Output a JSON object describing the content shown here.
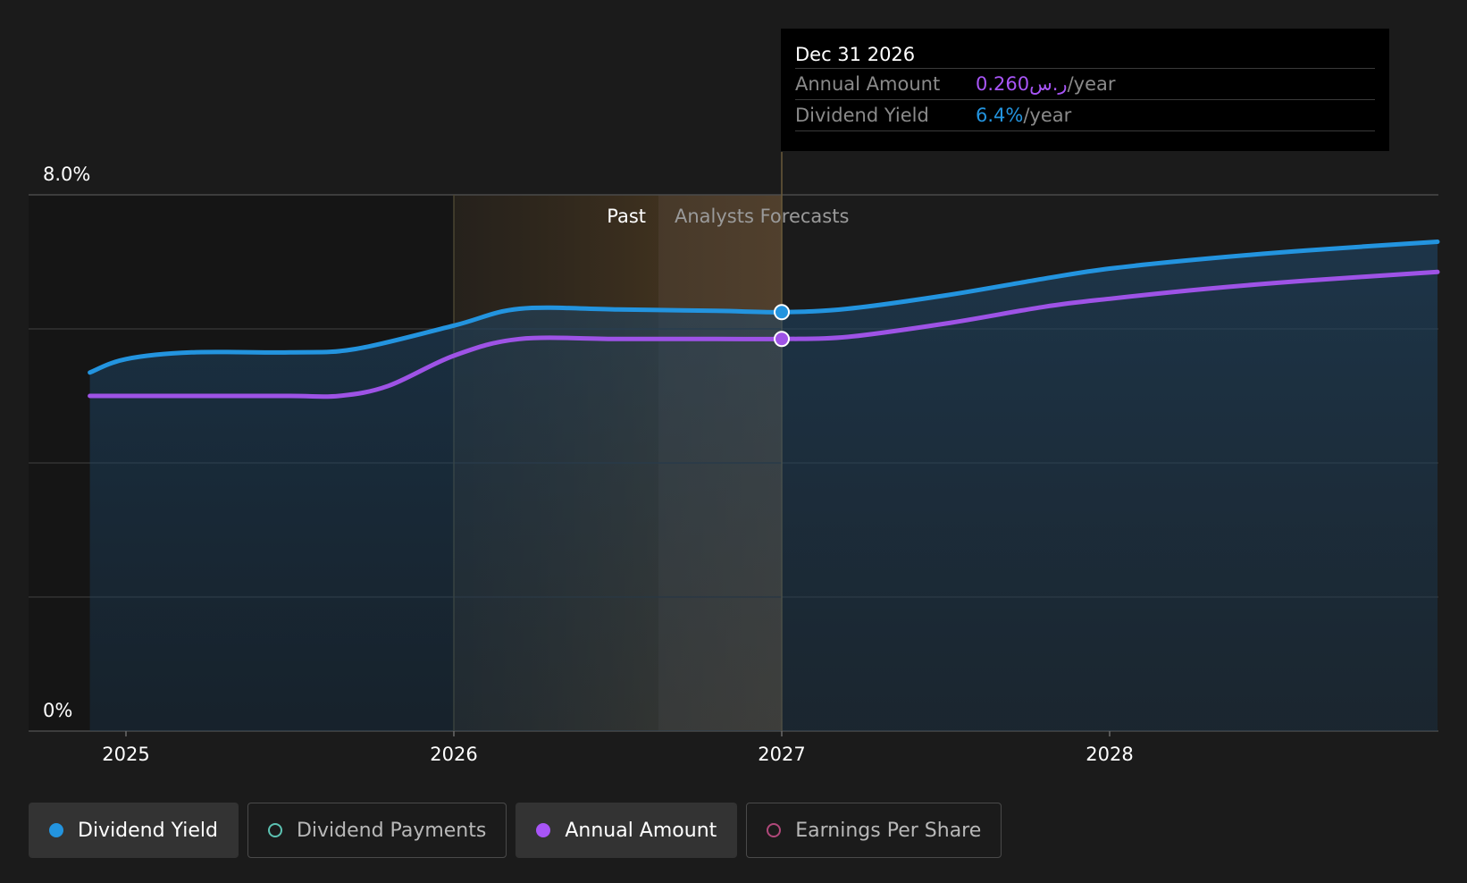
{
  "chart_data": {
    "type": "area",
    "y_axis": {
      "labels": [
        "8.0%",
        "0%"
      ],
      "range": [
        0,
        8
      ]
    },
    "x_axis": {
      "ticks": [
        {
          "label": "2025",
          "x": 2025.0
        },
        {
          "label": "2026",
          "x": 2026.0
        },
        {
          "label": "2027",
          "x": 2027.0
        },
        {
          "label": "2028",
          "x": 2028.0
        }
      ],
      "range": [
        2024.72,
        2029.0
      ]
    },
    "regions": {
      "past_label": "Past",
      "forecast_label": "Analysts Forecasts",
      "past_start": 2026.0,
      "divider": 2027.0
    },
    "series": [
      {
        "name": "Dividend Yield",
        "color": "#2394df",
        "fill": true,
        "points": [
          [
            2024.89,
            5.35
          ],
          [
            2025.0,
            5.55
          ],
          [
            2025.2,
            5.65
          ],
          [
            2025.5,
            5.65
          ],
          [
            2025.7,
            5.7
          ],
          [
            2026.0,
            6.05
          ],
          [
            2026.2,
            6.3
          ],
          [
            2026.5,
            6.29
          ],
          [
            2026.8,
            6.27
          ],
          [
            2027.0,
            6.25
          ],
          [
            2027.2,
            6.3
          ],
          [
            2027.5,
            6.5
          ],
          [
            2027.8,
            6.75
          ],
          [
            2028.0,
            6.9
          ],
          [
            2028.3,
            7.05
          ],
          [
            2028.6,
            7.17
          ],
          [
            2029.0,
            7.3
          ]
        ]
      },
      {
        "name": "Annual Amount",
        "color": "#9e53e6",
        "fill": false,
        "points": [
          [
            2024.89,
            5.0
          ],
          [
            2025.2,
            5.0
          ],
          [
            2025.5,
            5.0
          ],
          [
            2025.65,
            5.0
          ],
          [
            2025.8,
            5.15
          ],
          [
            2026.0,
            5.6
          ],
          [
            2026.2,
            5.85
          ],
          [
            2026.5,
            5.85
          ],
          [
            2026.8,
            5.85
          ],
          [
            2027.0,
            5.85
          ],
          [
            2027.2,
            5.88
          ],
          [
            2027.5,
            6.08
          ],
          [
            2027.8,
            6.33
          ],
          [
            2028.0,
            6.45
          ],
          [
            2028.3,
            6.6
          ],
          [
            2028.6,
            6.72
          ],
          [
            2029.0,
            6.85
          ]
        ]
      }
    ],
    "highlight": {
      "x": 2027.0,
      "yield": 6.25,
      "amount": 5.85
    }
  },
  "tooltip": {
    "date": "Dec 31 2026",
    "rows": [
      {
        "label": "Annual Amount",
        "value": "0.260ر.س",
        "unit": "/year",
        "color": "#a855f7"
      },
      {
        "label": "Dividend Yield",
        "value": "6.4%",
        "unit": "/year",
        "color": "#2394df"
      }
    ]
  },
  "legend": [
    {
      "label": "Dividend Yield",
      "active": true,
      "color": "#2394df",
      "filled": true
    },
    {
      "label": "Dividend Payments",
      "active": false,
      "color": "#5cc2b2",
      "filled": false
    },
    {
      "label": "Annual Amount",
      "active": true,
      "color": "#a855f7",
      "filled": true
    },
    {
      "label": "Earnings Per Share",
      "active": false,
      "color": "#b0487a",
      "filled": false
    }
  ]
}
